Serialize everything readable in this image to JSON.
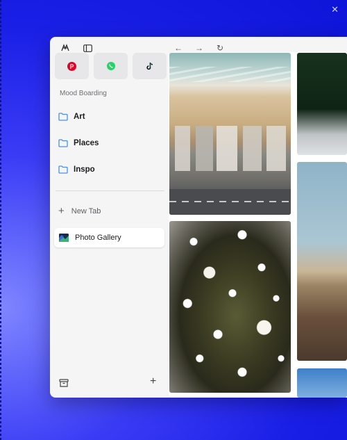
{
  "sidebar": {
    "section_label": "Mood Boarding",
    "folders": [
      {
        "label": "Art"
      },
      {
        "label": "Places"
      },
      {
        "label": "Inspo"
      }
    ],
    "new_tab_label": "New Tab",
    "active_tab_label": "Photo Gallery"
  },
  "favorites": [
    {
      "icon": "pinterest-icon",
      "color": "#e60023"
    },
    {
      "icon": "whatsapp-icon",
      "color": "#25d366"
    },
    {
      "icon": "tiktok-icon",
      "color": "#000000"
    }
  ],
  "colors": {
    "desktop_background": "#1a1fe6",
    "folder_icon": "#4a90e2"
  }
}
